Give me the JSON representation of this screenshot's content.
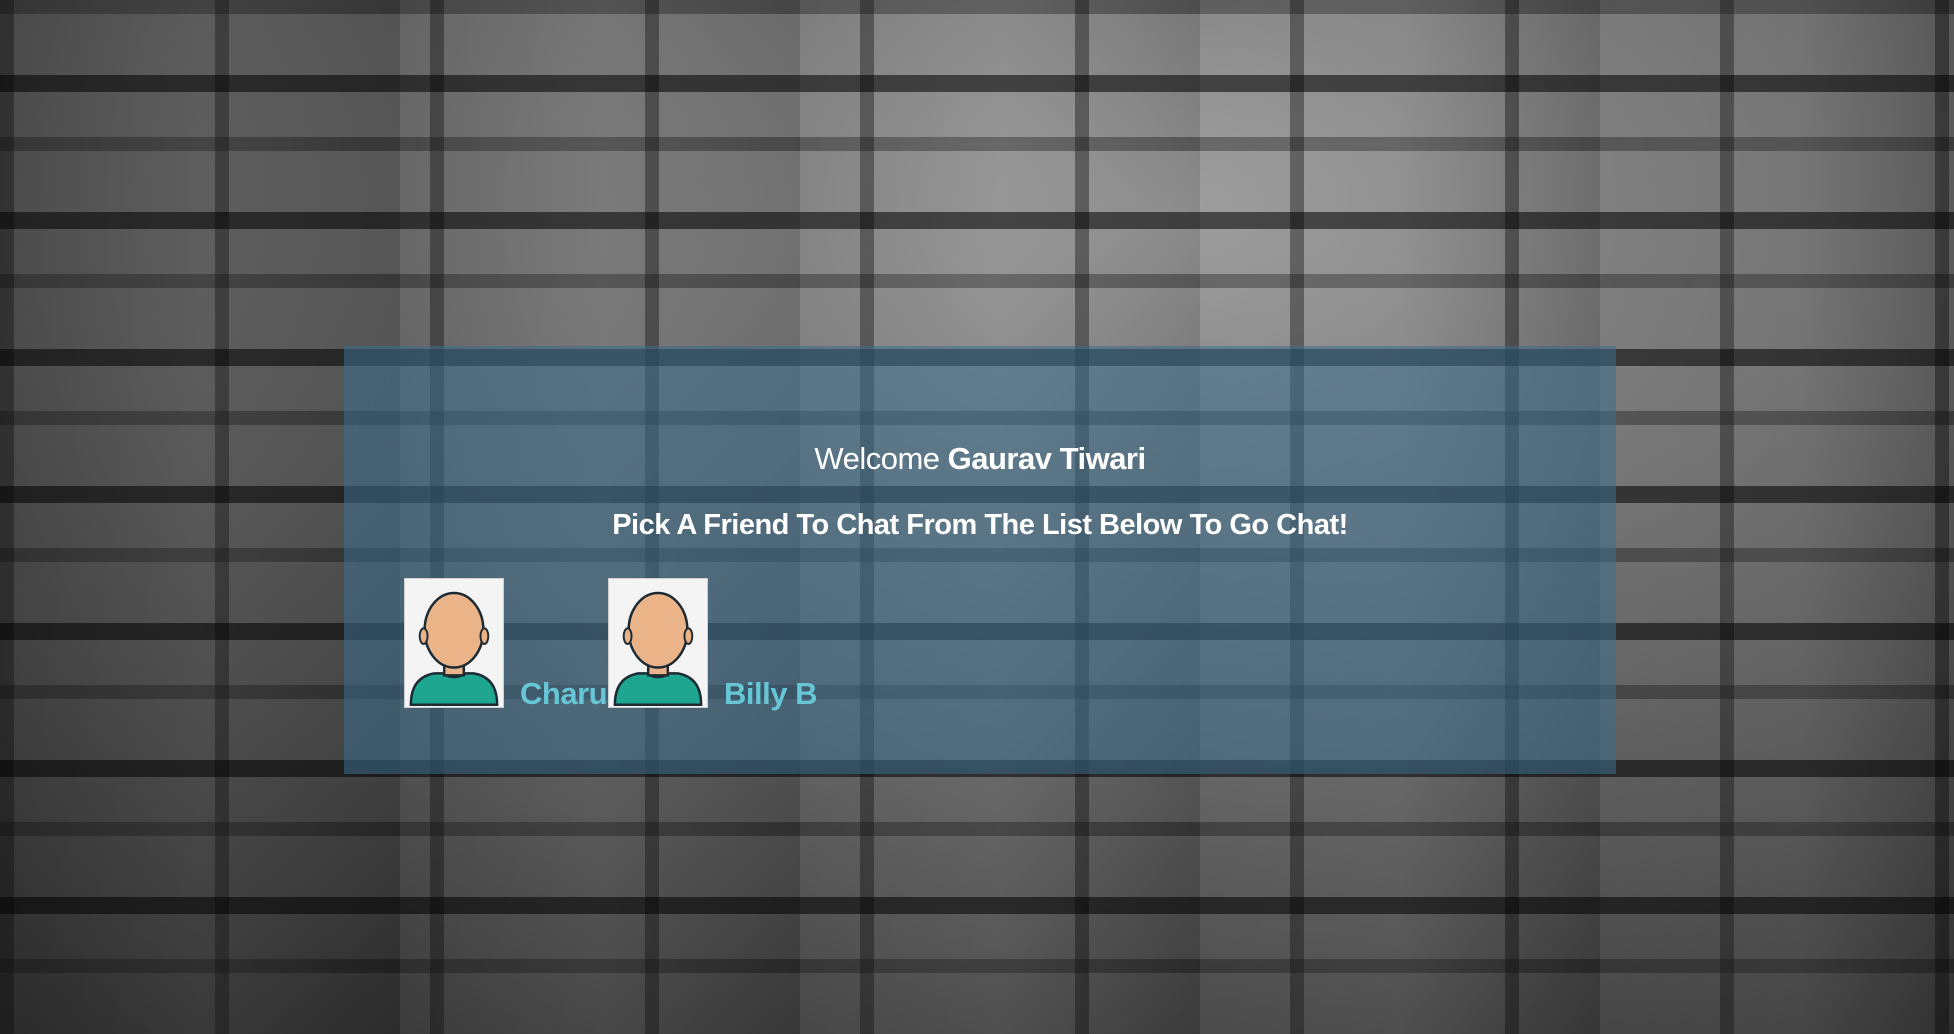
{
  "welcome": {
    "prefix": "Welcome",
    "user_name": "Gaurav Tiwari"
  },
  "instructions": "Pick A Friend To Chat From The List Below To Go Chat!",
  "friends": [
    {
      "name": "Charu",
      "icon": "person-avatar-icon"
    },
    {
      "name": "Billy B",
      "icon": "person-avatar-icon"
    }
  ],
  "colors": {
    "panel": "#3c6e8c",
    "friend_name": "#67c6d6",
    "text": "#ffffff",
    "avatar_skin": "#eab388",
    "avatar_shirt": "#1ea691"
  }
}
